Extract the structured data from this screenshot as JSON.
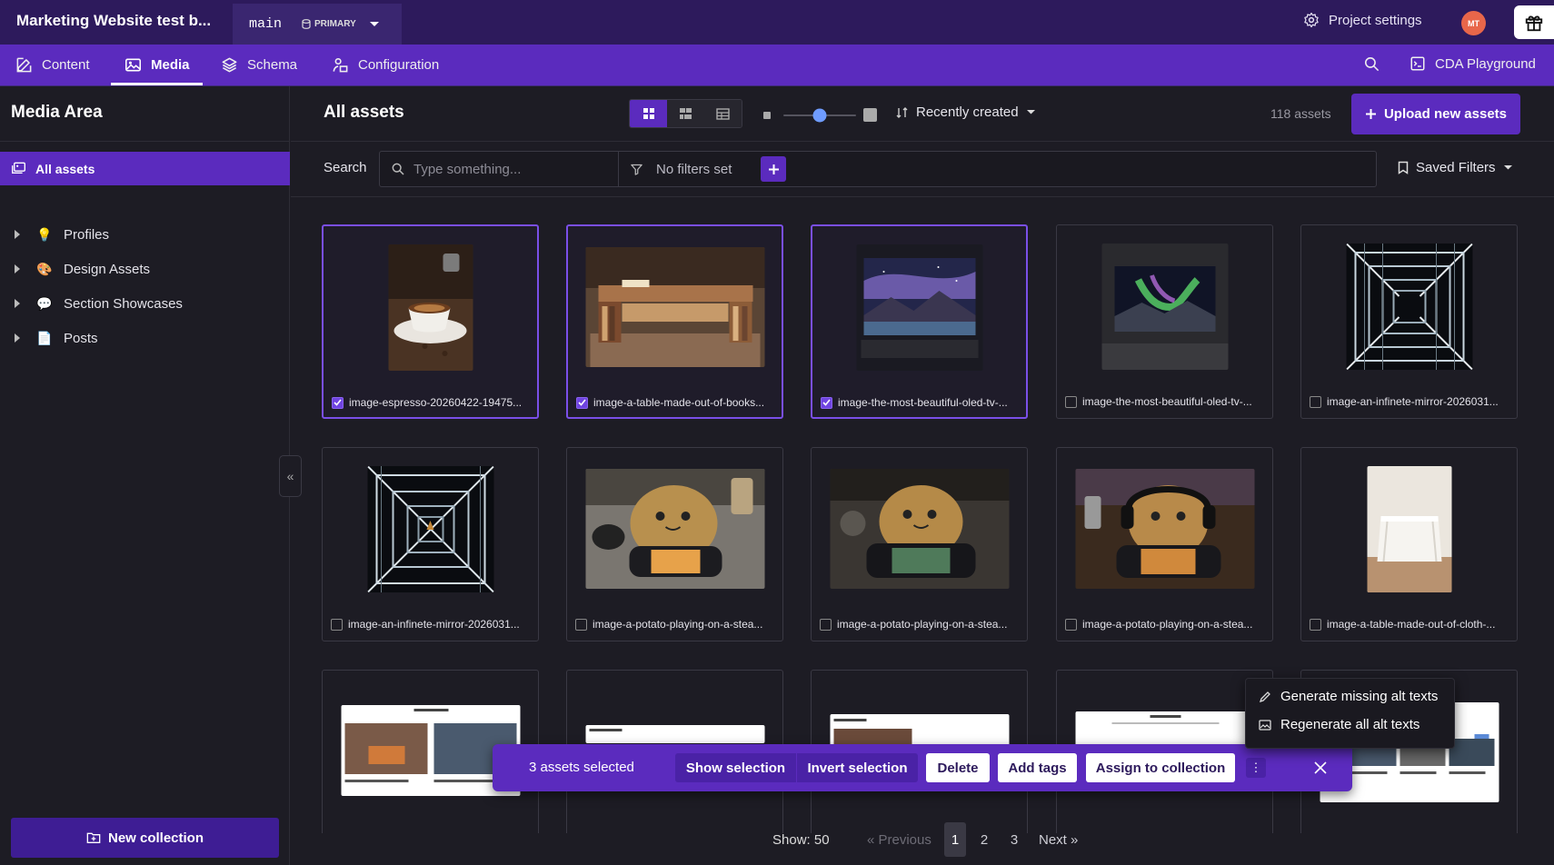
{
  "header": {
    "project_title": "Marketing Website test b...",
    "branch": "main",
    "environment": "PRIMARY",
    "project_settings": "Project settings",
    "avatar_initials": "MT"
  },
  "nav": {
    "items": [
      {
        "label": "Content",
        "icon": "edit-icon"
      },
      {
        "label": "Media",
        "icon": "image-icon"
      },
      {
        "label": "Schema",
        "icon": "layers-icon"
      },
      {
        "label": "Configuration",
        "icon": "config-icon"
      }
    ],
    "active": "Media",
    "cda_playground": "CDA Playground"
  },
  "sidebar": {
    "title": "Media Area",
    "all_assets": "All assets",
    "collections": [
      {
        "label": "Profiles",
        "icon": "💡"
      },
      {
        "label": "Design Assets",
        "icon": "🎨"
      },
      {
        "label": "Section Showcases",
        "icon": "💬"
      },
      {
        "label": "Posts",
        "icon": "📄"
      }
    ],
    "new_collection": "New collection"
  },
  "toolbar": {
    "title": "All assets",
    "sort_label": "Recently created",
    "asset_count": "118 assets",
    "upload_label": "Upload new assets"
  },
  "filters": {
    "search_label": "Search",
    "search_placeholder": "Type something...",
    "filter_state": "No filters set",
    "saved_filters": "Saved Filters"
  },
  "assets": [
    {
      "name": "image-espresso-20260422-19475...",
      "selected": true
    },
    {
      "name": "image-a-table-made-out-of-books...",
      "selected": true
    },
    {
      "name": "image-the-most-beautiful-oled-tv-...",
      "selected": true
    },
    {
      "name": "image-the-most-beautiful-oled-tv-...",
      "selected": false
    },
    {
      "name": "image-an-infinete-mirror-2026031...",
      "selected": false
    },
    {
      "name": "image-an-infinete-mirror-2026031...",
      "selected": false
    },
    {
      "name": "image-a-potato-playing-on-a-stea...",
      "selected": false
    },
    {
      "name": "image-a-potato-playing-on-a-stea...",
      "selected": false
    },
    {
      "name": "image-a-potato-playing-on-a-stea...",
      "selected": false
    },
    {
      "name": "image-a-table-made-out-of-cloth-...",
      "selected": false
    }
  ],
  "pagination": {
    "show": "Show: 50",
    "previous": "« Previous",
    "pages": [
      "1",
      "2",
      "3"
    ],
    "current": "1",
    "next": "Next »"
  },
  "selection_bar": {
    "count": "3 assets selected",
    "show_selection": "Show selection",
    "invert_selection": "Invert selection",
    "delete": "Delete",
    "add_tags": "Add tags",
    "assign": "Assign to collection"
  },
  "more_menu": {
    "generate": "Generate missing alt texts",
    "regenerate": "Regenerate all alt texts"
  },
  "colors": {
    "accent": "#5b2bbe",
    "header": "#2d1a5c",
    "background": "#1d1c24"
  }
}
